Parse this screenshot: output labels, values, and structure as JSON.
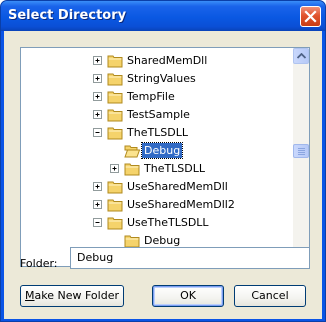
{
  "window": {
    "title": "Select Directory",
    "accent_color": "#0a54e6",
    "close_icon": "close-icon"
  },
  "tree": {
    "items": [
      {
        "label": "SharedMemDll",
        "expander": "plus",
        "level": 0
      },
      {
        "label": "StringValues",
        "expander": "plus",
        "level": 0
      },
      {
        "label": "TempFile",
        "expander": "plus",
        "level": 0
      },
      {
        "label": "TestSample",
        "expander": "plus",
        "level": 0
      },
      {
        "label": "TheTLSDLL",
        "expander": "minus",
        "level": 0
      },
      {
        "label": "Debug",
        "expander": "none",
        "level": 1,
        "selected": true,
        "open_folder": true
      },
      {
        "label": "TheTLSDLL",
        "expander": "plus",
        "level": 1
      },
      {
        "label": "UseSharedMemDll",
        "expander": "plus",
        "level": 0
      },
      {
        "label": "UseSharedMemDll2",
        "expander": "plus",
        "level": 0
      },
      {
        "label": "UseTheTLSDLL",
        "expander": "minus",
        "level": 0
      },
      {
        "label": "Debug",
        "expander": "none",
        "level": 1
      }
    ],
    "selection_color": "#316ac5"
  },
  "folder": {
    "label": "Folder:",
    "value": "Debug"
  },
  "buttons": {
    "make_new_folder_prefix": "M",
    "make_new_folder_rest": "ake New Folder",
    "ok": "OK",
    "cancel": "Cancel"
  }
}
